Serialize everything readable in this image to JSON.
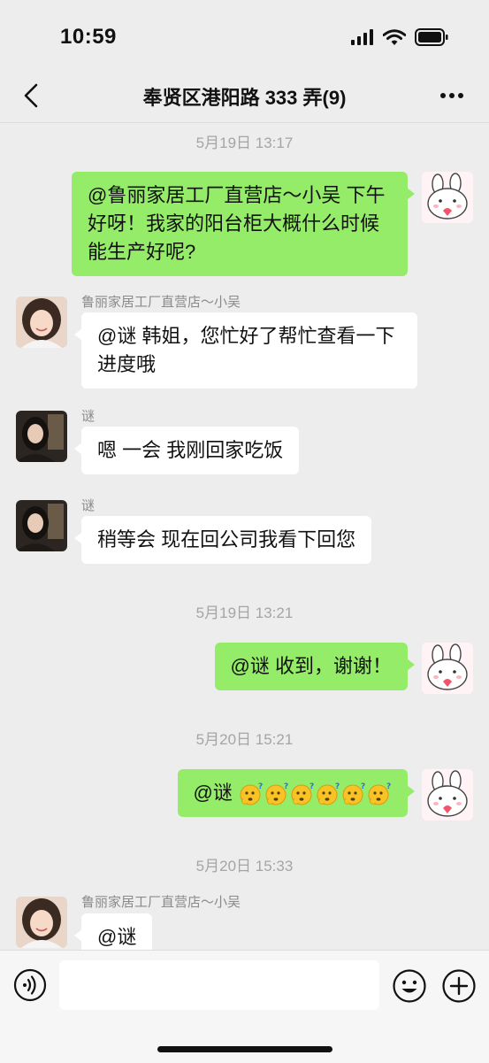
{
  "status_bar": {
    "time": "10:59"
  },
  "nav": {
    "title": "奉贤区港阳路 333 弄(9)"
  },
  "messages": [
    {
      "timestamp": "5月19日 13:17"
    },
    {
      "text": "@鲁丽家居工厂直营店～小吴 下午好呀！我家的阳台柜大概什么时候能生产好呢?"
    },
    {
      "sender": "鲁丽家居工厂直营店～小吴",
      "text": "@谜 韩姐，您忙好了帮忙查看一下进度哦"
    },
    {
      "sender": "谜",
      "text": "嗯 一会 我刚回家吃饭"
    },
    {
      "sender": "谜",
      "text": "稍等会 现在回公司我看下回您"
    },
    {
      "timestamp": "5月19日 13:21"
    },
    {
      "text": "@谜 收到，谢谢！"
    },
    {
      "timestamp": "5月20日 15:21"
    },
    {
      "text": "@谜",
      "emoji": "confused-face-emoji",
      "emoji_count": 6
    },
    {
      "timestamp": "5月20日 15:33"
    },
    {
      "sender": "鲁丽家居工厂直营店～小吴",
      "text": "@谜"
    }
  ],
  "input": {
    "placeholder": ""
  },
  "icons": [
    "back-arrow-icon",
    "more-options-icon",
    "voice-icon",
    "emoji-icon",
    "plus-icon"
  ],
  "colors": {
    "outgoing_bubble": "#95ec69",
    "incoming_bubble": "#ffffff",
    "background": "#ededed"
  }
}
